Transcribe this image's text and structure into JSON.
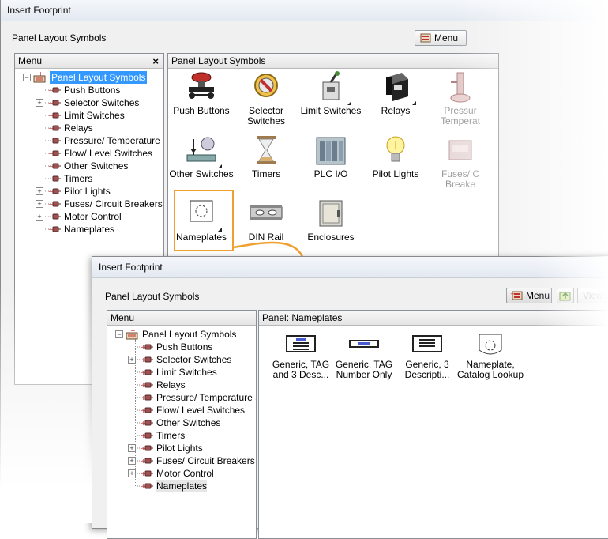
{
  "back_window": {
    "title": "Insert Footprint",
    "header_label": "Panel Layout Symbols",
    "menu_button_label": "Menu",
    "menu_panel": {
      "title": "Menu",
      "close_symbol": "×",
      "root_label": "Panel Layout Symbols",
      "items": [
        {
          "label": "Push Buttons"
        },
        {
          "label": "Selector Switches"
        },
        {
          "label": "Limit Switches"
        },
        {
          "label": "Relays"
        },
        {
          "label": "Pressure/ Temperature Sw"
        },
        {
          "label": "Flow/ Level Switches"
        },
        {
          "label": "Other Switches"
        },
        {
          "label": "Timers"
        },
        {
          "label": "Pilot Lights"
        },
        {
          "label": "Fuses/ Circuit Breakers"
        },
        {
          "label": "Motor Control"
        },
        {
          "label": "Nameplates"
        }
      ]
    },
    "symbols_panel": {
      "title": "Panel Layout Symbols",
      "tiles": [
        {
          "label": "Push Buttons",
          "icon": "push-button-icon"
        },
        {
          "label": "Selector\nSwitches",
          "icon": "selector-switch-icon"
        },
        {
          "label": "Limit Switches",
          "icon": "limit-switch-icon"
        },
        {
          "label": "Relays",
          "icon": "relay-icon"
        },
        {
          "label": "Pressur\nTemperat",
          "icon": "pressure-gauge-icon"
        },
        {
          "label": "Other Switches",
          "icon": "other-switch-icon"
        },
        {
          "label": "Timers",
          "icon": "hourglass-icon"
        },
        {
          "label": "PLC I/O",
          "icon": "plc-icon"
        },
        {
          "label": "Pilot Lights",
          "icon": "light-bulb-icon"
        },
        {
          "label": "Fuses/ C\nBreake",
          "icon": "fuse-icon"
        },
        {
          "label": "Nameplates",
          "icon": "nameplate-icon"
        },
        {
          "label": "DIN Rail",
          "icon": "din-rail-icon"
        },
        {
          "label": "Enclosures",
          "icon": "enclosure-icon"
        }
      ]
    }
  },
  "front_window": {
    "title": "Insert Footprint",
    "header_label": "Panel Layout Symbols",
    "menu_button_label": "Menu",
    "views_button_label": "Views",
    "menu_panel": {
      "title": "Menu",
      "root_label": "Panel Layout Symbols",
      "items": [
        {
          "label": "Push Buttons"
        },
        {
          "label": "Selector Switches"
        },
        {
          "label": "Limit Switches"
        },
        {
          "label": "Relays"
        },
        {
          "label": "Pressure/ Temperature Sw"
        },
        {
          "label": "Flow/ Level Switches"
        },
        {
          "label": "Other Switches"
        },
        {
          "label": "Timers"
        },
        {
          "label": "Pilot Lights"
        },
        {
          "label": "Fuses/ Circuit Breakers"
        },
        {
          "label": "Motor Control"
        },
        {
          "label": "Nameplates"
        }
      ]
    },
    "nameplates_panel": {
      "title": "Panel: Nameplates",
      "tiles": [
        {
          "label": "Generic, TAG\nand 3 Desc...",
          "icon": "nameplate-tag-desc-icon"
        },
        {
          "label": "Generic, TAG\nNumber Only",
          "icon": "nameplate-tag-only-icon"
        },
        {
          "label": "Generic, 3\nDescripti...",
          "icon": "nameplate-3-desc-icon"
        },
        {
          "label": "Nameplate,\nCatalog Lookup",
          "icon": "nameplate-catalog-icon"
        }
      ]
    }
  },
  "colors": {
    "selection": "#3399ff",
    "highlight_arrow": "#f0a030",
    "dialog_bg": "#f0f0f0"
  }
}
